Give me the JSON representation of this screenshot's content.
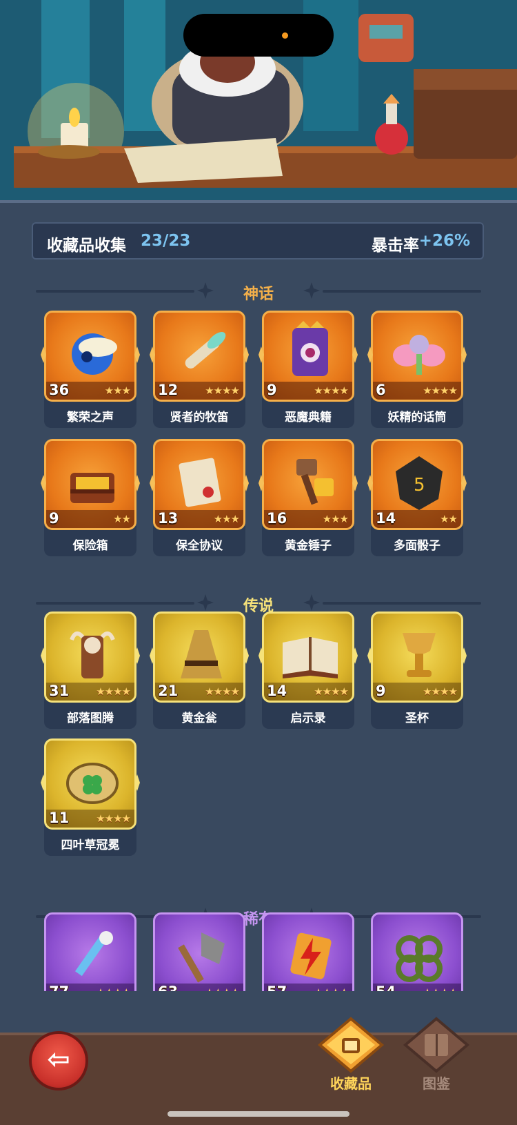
{
  "header": {
    "title": "收藏品收集",
    "count": "23/23",
    "crit_label": "暴击率",
    "crit_value": "+26%"
  },
  "sections": [
    {
      "title": "神话",
      "tier": "mythic",
      "color": "#f4b04a",
      "items": [
        {
          "name": "繁荣之声",
          "level": "36",
          "stars": "★★★",
          "icon": "orb-bird-icon"
        },
        {
          "name": "贤者的牧笛",
          "level": "12",
          "stars": "★★★★",
          "icon": "flute-icon"
        },
        {
          "name": "恶魔典籍",
          "level": "9",
          "stars": "★★★★",
          "icon": "demon-book-icon"
        },
        {
          "name": "妖精的话筒",
          "level": "6",
          "stars": "★★★★",
          "icon": "fairy-mic-icon"
        },
        {
          "name": "保险箱",
          "level": "9",
          "stars": "★★",
          "icon": "treasure-chest-icon"
        },
        {
          "name": "保全协议",
          "level": "13",
          "stars": "★★★",
          "icon": "contract-icon"
        },
        {
          "name": "黄金锤子",
          "level": "16",
          "stars": "★★★",
          "icon": "golden-hammer-icon"
        },
        {
          "name": "多面骰子",
          "level": "14",
          "stars": "★★",
          "icon": "dice-icon"
        }
      ]
    },
    {
      "title": "传说",
      "tier": "legend",
      "color": "#f6e27a",
      "items": [
        {
          "name": "部落图腾",
          "level": "31",
          "stars": "★★★★",
          "icon": "totem-icon"
        },
        {
          "name": "黄金瓮",
          "level": "21",
          "stars": "★★★★",
          "icon": "golden-urn-icon"
        },
        {
          "name": "启示录",
          "level": "14",
          "stars": "★★★★",
          "icon": "open-book-icon"
        },
        {
          "name": "圣杯",
          "level": "9",
          "stars": "★★★★",
          "icon": "grail-icon"
        },
        {
          "name": "四叶草冠冕",
          "level": "11",
          "stars": "★★★★",
          "icon": "clover-crown-icon"
        }
      ]
    },
    {
      "title": "稀有",
      "tier": "rare",
      "color": "#c595f0",
      "items": [
        {
          "name": "",
          "level": "77",
          "stars": "★★★★",
          "icon": "ice-sword-icon"
        },
        {
          "name": "",
          "level": "63",
          "stars": "★★★★",
          "icon": "stone-axe-icon"
        },
        {
          "name": "",
          "level": "57",
          "stars": "★★★★",
          "icon": "lightning-scroll-icon"
        },
        {
          "name": "",
          "level": "54",
          "stars": "★★★★",
          "icon": "thorn-rings-icon"
        }
      ]
    }
  ],
  "tabs": [
    {
      "label": "收藏品",
      "active": true,
      "color": "#ffd45a"
    },
    {
      "label": "图鉴",
      "active": false,
      "color": "#a58a7c"
    }
  ]
}
